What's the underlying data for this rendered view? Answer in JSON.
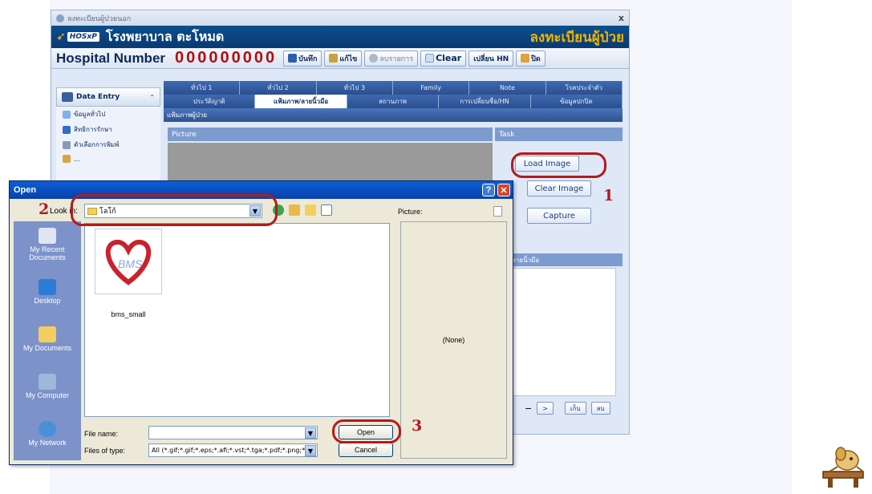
{
  "app": {
    "window_title": "ลงทะเบียนผู้ป่วยนอก",
    "close_glyph": "x",
    "logo_text": "HOSxP",
    "hospital_name": "โรงพยาบาล ตะโหมด",
    "banner_title": "ลงทะเบียนผู้ป่วย",
    "hn_label": "Hospital Number",
    "hn_value": "000000000",
    "toolbar": {
      "save": "บันทึก",
      "edit": "แก้ไข",
      "delete": "ลบรายการ",
      "clear": "Clear",
      "change_hn": "เปลี่ยน HN",
      "close": "ปิด"
    },
    "data_entry": {
      "title": "Data Entry",
      "items": [
        "ข้อมูลทั่วไป",
        "สิทธิการรักษา",
        "ตัวเลือกการพิมพ์",
        "..."
      ]
    },
    "tabs_row1": [
      "ทั่วไป 1",
      "ทั่วไป 2",
      "ทั่วไป 3",
      "Family",
      "Note",
      "โรคประจำตัว"
    ],
    "tabs_row2": [
      "ประวัติญาติ",
      "แฟ้มภาพ/ลายนิ้วมือ",
      "สถานภาพ",
      "การเปลี่ยนชื่อ/HN",
      "ข้อมูลปกปิด"
    ],
    "active_tab": "แฟ้มภาพ/ลายนิ้วมือ",
    "section_title": "แฟ้มภาพผู้ป่วย",
    "picture_header": "Picture",
    "task_header": "Task",
    "task_buttons": {
      "load": "Load Image",
      "clear": "Clear Image",
      "capture": "Capture"
    },
    "signature_header": "ลายนิ้วมือ",
    "nav": {
      "minus": "−",
      "next": ">",
      "keep": "เก็บ",
      "delete": "ลบ"
    }
  },
  "dialog": {
    "title": "Open",
    "help": "?",
    "close": "✕",
    "look_in_label": "Look in:",
    "look_in_value": "โลโก้",
    "picture_label": "Picture:",
    "preview_text": "(None)",
    "places": [
      "My Recent Documents",
      "Desktop",
      "My Documents",
      "My Computer",
      "My Network"
    ],
    "files": [
      {
        "name": "bms_small",
        "thumb_text": "BMS"
      }
    ],
    "file_name_label": "File name:",
    "file_name_value": "",
    "files_of_type_label": "Files of type:",
    "files_of_type_value": "All (*.gif;*.gif;*.eps;*.afi;*.vst;*.tga;*.pdf;*.png;*.d",
    "open_button": "Open",
    "cancel_button": "Cancel"
  },
  "annotations": [
    "1",
    "2",
    "3"
  ],
  "colors": {
    "annotation": "#b31b1b",
    "banner": "#0a3a73",
    "hn_number": "#b01010",
    "dialog_title": "#0a5fd8"
  }
}
